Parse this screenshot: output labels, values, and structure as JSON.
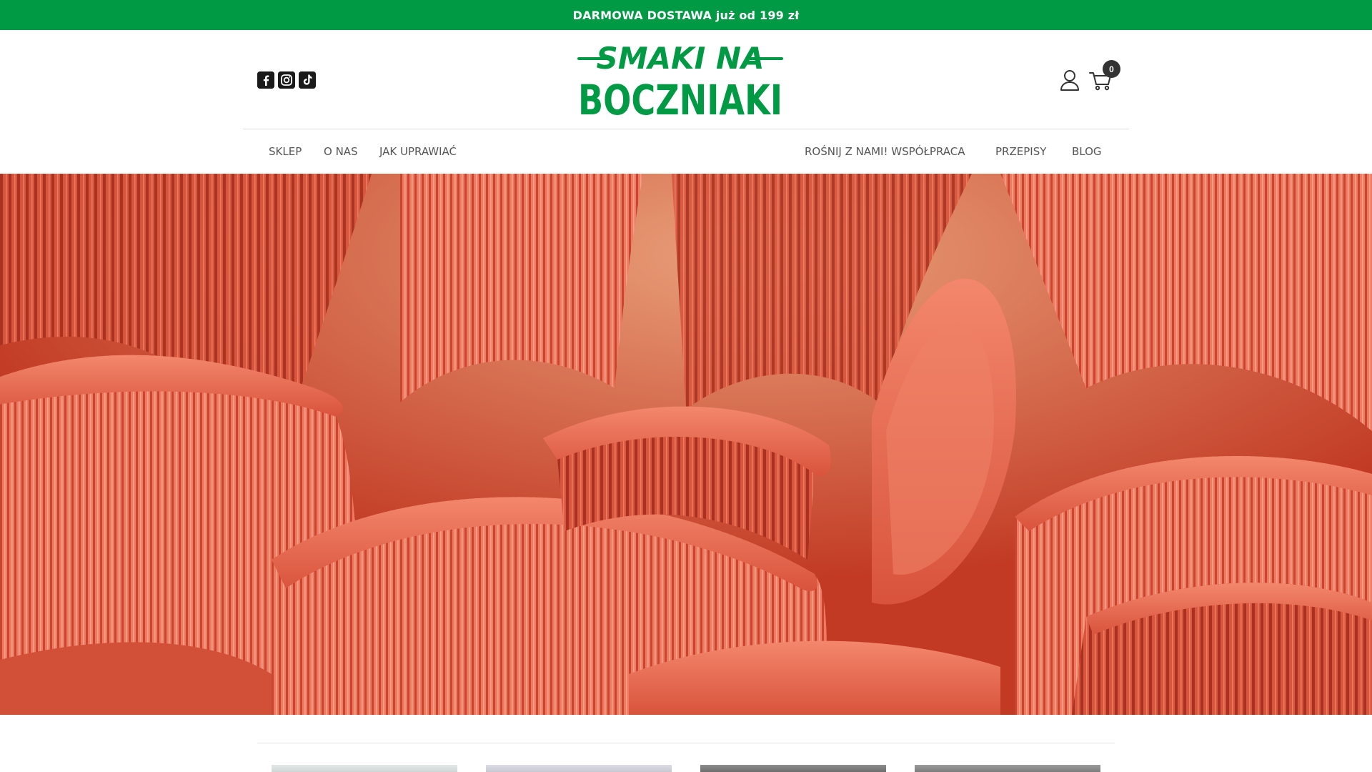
{
  "promo": {
    "text": "DARMOWA DOSTAWA już od 199 zł"
  },
  "brand": {
    "logo_line1": "SMAKI NA",
    "logo_line2": "BOCZNIAKI",
    "color": "#009a44"
  },
  "social": [
    {
      "name": "facebook-icon"
    },
    {
      "name": "instagram-icon"
    },
    {
      "name": "tiktok-icon"
    }
  ],
  "header": {
    "cart_count": "0"
  },
  "nav": {
    "left": [
      {
        "label": "SKLEP"
      },
      {
        "label": "O NAS"
      },
      {
        "label": "JAK UPRAWIAĆ"
      }
    ],
    "right": [
      {
        "label": "ROŚNIJ Z NAMI! WSPÓŁPRACA"
      },
      {
        "label": "PRZEPISY"
      },
      {
        "label": "BLOG"
      }
    ]
  },
  "hero": {
    "subject": "pink oyster mushrooms close-up",
    "accent": "#e8604a"
  }
}
